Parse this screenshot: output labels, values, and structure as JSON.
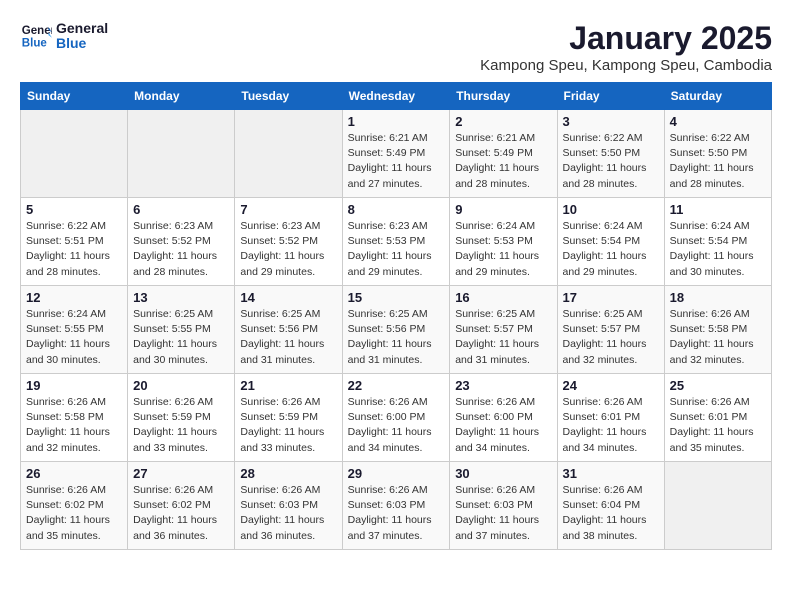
{
  "header": {
    "logo_line1": "General",
    "logo_line2": "Blue",
    "title": "January 2025",
    "subtitle": "Kampong Speu, Kampong Speu, Cambodia"
  },
  "weekdays": [
    "Sunday",
    "Monday",
    "Tuesday",
    "Wednesday",
    "Thursday",
    "Friday",
    "Saturday"
  ],
  "weeks": [
    [
      {
        "day": "",
        "sunrise": "",
        "sunset": "",
        "daylight": ""
      },
      {
        "day": "",
        "sunrise": "",
        "sunset": "",
        "daylight": ""
      },
      {
        "day": "",
        "sunrise": "",
        "sunset": "",
        "daylight": ""
      },
      {
        "day": "1",
        "sunrise": "Sunrise: 6:21 AM",
        "sunset": "Sunset: 5:49 PM",
        "daylight": "Daylight: 11 hours and 27 minutes."
      },
      {
        "day": "2",
        "sunrise": "Sunrise: 6:21 AM",
        "sunset": "Sunset: 5:49 PM",
        "daylight": "Daylight: 11 hours and 28 minutes."
      },
      {
        "day": "3",
        "sunrise": "Sunrise: 6:22 AM",
        "sunset": "Sunset: 5:50 PM",
        "daylight": "Daylight: 11 hours and 28 minutes."
      },
      {
        "day": "4",
        "sunrise": "Sunrise: 6:22 AM",
        "sunset": "Sunset: 5:50 PM",
        "daylight": "Daylight: 11 hours and 28 minutes."
      }
    ],
    [
      {
        "day": "5",
        "sunrise": "Sunrise: 6:22 AM",
        "sunset": "Sunset: 5:51 PM",
        "daylight": "Daylight: 11 hours and 28 minutes."
      },
      {
        "day": "6",
        "sunrise": "Sunrise: 6:23 AM",
        "sunset": "Sunset: 5:52 PM",
        "daylight": "Daylight: 11 hours and 28 minutes."
      },
      {
        "day": "7",
        "sunrise": "Sunrise: 6:23 AM",
        "sunset": "Sunset: 5:52 PM",
        "daylight": "Daylight: 11 hours and 29 minutes."
      },
      {
        "day": "8",
        "sunrise": "Sunrise: 6:23 AM",
        "sunset": "Sunset: 5:53 PM",
        "daylight": "Daylight: 11 hours and 29 minutes."
      },
      {
        "day": "9",
        "sunrise": "Sunrise: 6:24 AM",
        "sunset": "Sunset: 5:53 PM",
        "daylight": "Daylight: 11 hours and 29 minutes."
      },
      {
        "day": "10",
        "sunrise": "Sunrise: 6:24 AM",
        "sunset": "Sunset: 5:54 PM",
        "daylight": "Daylight: 11 hours and 29 minutes."
      },
      {
        "day": "11",
        "sunrise": "Sunrise: 6:24 AM",
        "sunset": "Sunset: 5:54 PM",
        "daylight": "Daylight: 11 hours and 30 minutes."
      }
    ],
    [
      {
        "day": "12",
        "sunrise": "Sunrise: 6:24 AM",
        "sunset": "Sunset: 5:55 PM",
        "daylight": "Daylight: 11 hours and 30 minutes."
      },
      {
        "day": "13",
        "sunrise": "Sunrise: 6:25 AM",
        "sunset": "Sunset: 5:55 PM",
        "daylight": "Daylight: 11 hours and 30 minutes."
      },
      {
        "day": "14",
        "sunrise": "Sunrise: 6:25 AM",
        "sunset": "Sunset: 5:56 PM",
        "daylight": "Daylight: 11 hours and 31 minutes."
      },
      {
        "day": "15",
        "sunrise": "Sunrise: 6:25 AM",
        "sunset": "Sunset: 5:56 PM",
        "daylight": "Daylight: 11 hours and 31 minutes."
      },
      {
        "day": "16",
        "sunrise": "Sunrise: 6:25 AM",
        "sunset": "Sunset: 5:57 PM",
        "daylight": "Daylight: 11 hours and 31 minutes."
      },
      {
        "day": "17",
        "sunrise": "Sunrise: 6:25 AM",
        "sunset": "Sunset: 5:57 PM",
        "daylight": "Daylight: 11 hours and 32 minutes."
      },
      {
        "day": "18",
        "sunrise": "Sunrise: 6:26 AM",
        "sunset": "Sunset: 5:58 PM",
        "daylight": "Daylight: 11 hours and 32 minutes."
      }
    ],
    [
      {
        "day": "19",
        "sunrise": "Sunrise: 6:26 AM",
        "sunset": "Sunset: 5:58 PM",
        "daylight": "Daylight: 11 hours and 32 minutes."
      },
      {
        "day": "20",
        "sunrise": "Sunrise: 6:26 AM",
        "sunset": "Sunset: 5:59 PM",
        "daylight": "Daylight: 11 hours and 33 minutes."
      },
      {
        "day": "21",
        "sunrise": "Sunrise: 6:26 AM",
        "sunset": "Sunset: 5:59 PM",
        "daylight": "Daylight: 11 hours and 33 minutes."
      },
      {
        "day": "22",
        "sunrise": "Sunrise: 6:26 AM",
        "sunset": "Sunset: 6:00 PM",
        "daylight": "Daylight: 11 hours and 34 minutes."
      },
      {
        "day": "23",
        "sunrise": "Sunrise: 6:26 AM",
        "sunset": "Sunset: 6:00 PM",
        "daylight": "Daylight: 11 hours and 34 minutes."
      },
      {
        "day": "24",
        "sunrise": "Sunrise: 6:26 AM",
        "sunset": "Sunset: 6:01 PM",
        "daylight": "Daylight: 11 hours and 34 minutes."
      },
      {
        "day": "25",
        "sunrise": "Sunrise: 6:26 AM",
        "sunset": "Sunset: 6:01 PM",
        "daylight": "Daylight: 11 hours and 35 minutes."
      }
    ],
    [
      {
        "day": "26",
        "sunrise": "Sunrise: 6:26 AM",
        "sunset": "Sunset: 6:02 PM",
        "daylight": "Daylight: 11 hours and 35 minutes."
      },
      {
        "day": "27",
        "sunrise": "Sunrise: 6:26 AM",
        "sunset": "Sunset: 6:02 PM",
        "daylight": "Daylight: 11 hours and 36 minutes."
      },
      {
        "day": "28",
        "sunrise": "Sunrise: 6:26 AM",
        "sunset": "Sunset: 6:03 PM",
        "daylight": "Daylight: 11 hours and 36 minutes."
      },
      {
        "day": "29",
        "sunrise": "Sunrise: 6:26 AM",
        "sunset": "Sunset: 6:03 PM",
        "daylight": "Daylight: 11 hours and 37 minutes."
      },
      {
        "day": "30",
        "sunrise": "Sunrise: 6:26 AM",
        "sunset": "Sunset: 6:03 PM",
        "daylight": "Daylight: 11 hours and 37 minutes."
      },
      {
        "day": "31",
        "sunrise": "Sunrise: 6:26 AM",
        "sunset": "Sunset: 6:04 PM",
        "daylight": "Daylight: 11 hours and 38 minutes."
      },
      {
        "day": "",
        "sunrise": "",
        "sunset": "",
        "daylight": ""
      }
    ]
  ]
}
